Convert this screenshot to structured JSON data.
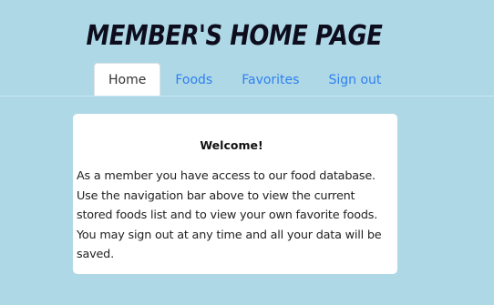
{
  "header": {
    "title": "MEMBER'S HOME PAGE"
  },
  "nav": {
    "tabs": [
      {
        "label": "Home",
        "active": true
      },
      {
        "label": "Foods",
        "active": false
      },
      {
        "label": "Favorites",
        "active": false
      },
      {
        "label": "Sign out",
        "active": false
      }
    ]
  },
  "welcome": {
    "heading": "Welcome!",
    "body": "As a member you have access to our food database. Use the navigation bar above to view the current stored foods list and to view your own favorite foods. You may sign out at any time and all your data will be saved."
  },
  "colors": {
    "background": "#aed8e6",
    "link": "#2f7ff0",
    "card": "#ffffff"
  }
}
